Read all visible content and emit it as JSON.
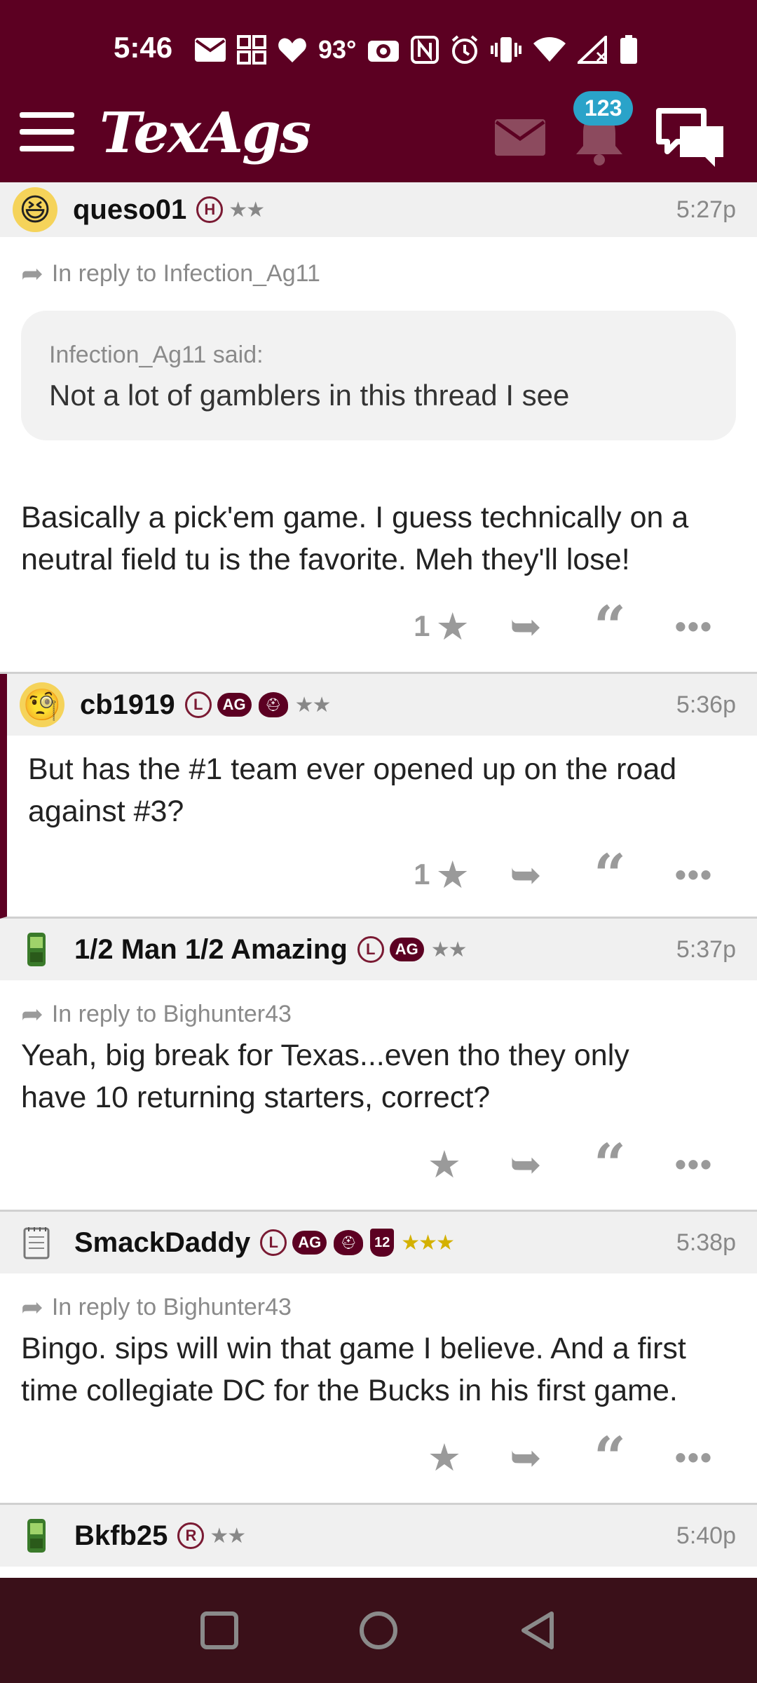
{
  "status_bar": {
    "time": "5:46",
    "temperature": "93°",
    "icons": [
      "mail-icon",
      "widgets-icon",
      "heart-icon",
      "temperature-text",
      "camera-icon",
      "nfc-icon",
      "alarm-icon",
      "vibrate-icon",
      "wifi-icon",
      "signal-icon",
      "battery-icon"
    ]
  },
  "header": {
    "logo": "TexAgs",
    "notification_count": "123",
    "brand_color": "#5c0022",
    "badge_color": "#2aa3c9"
  },
  "posts": [
    {
      "username": "queso01",
      "badges": [
        "H"
      ],
      "stars": "★★",
      "time": "5:27p",
      "reply_to": "In reply to Infection_Ag11",
      "quote_author": "Infection_Ag11 said:",
      "quote_text": "Not a lot of gamblers in this thread I see",
      "text_line1": "Basically a pick'em game. I guess technically on a",
      "text_line2": "neutral field tu is the favorite. Meh they'll lose!",
      "likes": "1"
    },
    {
      "username": "cb1919",
      "badges": [
        "L",
        "AG"
      ],
      "stars": "★★",
      "time": "5:36p",
      "text_line1": "But has the #1 team ever opened up on the road",
      "text_line2": "against #3?",
      "likes": "1"
    },
    {
      "username": "1/2 Man 1/2 Amazing",
      "badges": [
        "L",
        "AG"
      ],
      "stars": "★★",
      "time": "5:37p",
      "reply_to": "In reply to Bighunter43",
      "text_line1": "Yeah, big break for Texas...even tho they only",
      "text_line2": "have 10 returning starters, correct?",
      "likes": ""
    },
    {
      "username": "SmackDaddy",
      "badges": [
        "L",
        "AG",
        "12"
      ],
      "stars": "★★★",
      "time": "5:38p",
      "reply_to": "In reply to Bighunter43",
      "text_line1": "Bingo. sips will win that game I believe. And a first",
      "text_line2": "time collegiate DC for the Bucks in his first game.",
      "likes": ""
    },
    {
      "username": "Bkfb25",
      "badges": [
        "R"
      ],
      "stars": "★★",
      "time": "5:40p"
    }
  ],
  "actions": {
    "more_label": "•••"
  }
}
